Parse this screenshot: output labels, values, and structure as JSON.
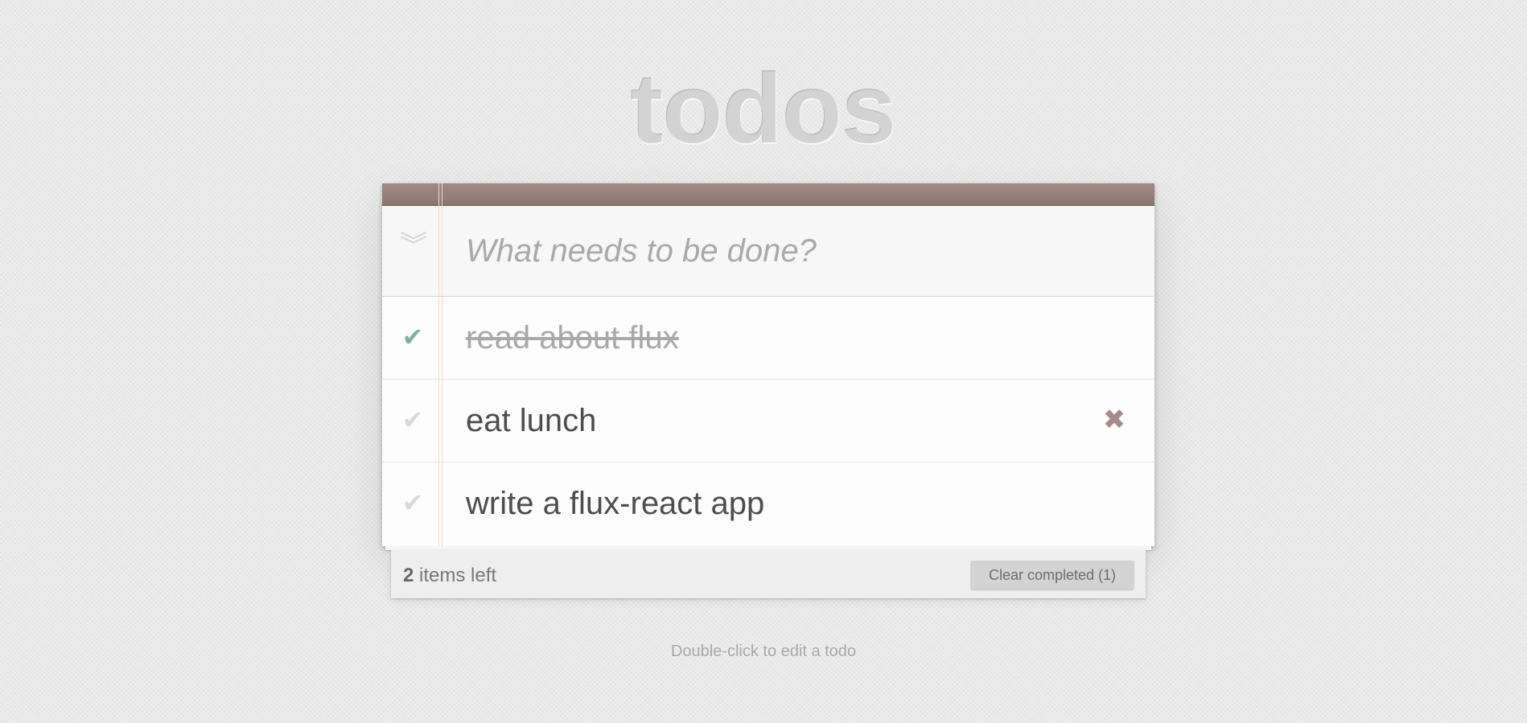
{
  "header": {
    "title": "todos"
  },
  "new_todo": {
    "placeholder": "What needs to be done?",
    "value": "",
    "toggle_all_icon": "double-chevron-down-icon"
  },
  "todos": [
    {
      "label": "read about flux",
      "completed": true,
      "toggle_icon": "checkmark-icon"
    },
    {
      "label": "eat lunch",
      "completed": false,
      "toggle_icon": "checkmark-icon",
      "hovered": true,
      "destroy_icon": "close-x-icon"
    },
    {
      "label": "write a flux-react app",
      "completed": false,
      "toggle_icon": "checkmark-icon"
    }
  ],
  "footer": {
    "count": "2",
    "count_suffix": " items left",
    "clear_completed_label": "Clear completed (1)"
  },
  "info": {
    "hint": "Double-click to edit a todo"
  },
  "colors": {
    "header_band": "#8a7770",
    "check_done": "#85ada7",
    "check_pending": "#d9d9d9",
    "destroy": "#a88a8a",
    "margin_line": "#f5d6d6"
  }
}
